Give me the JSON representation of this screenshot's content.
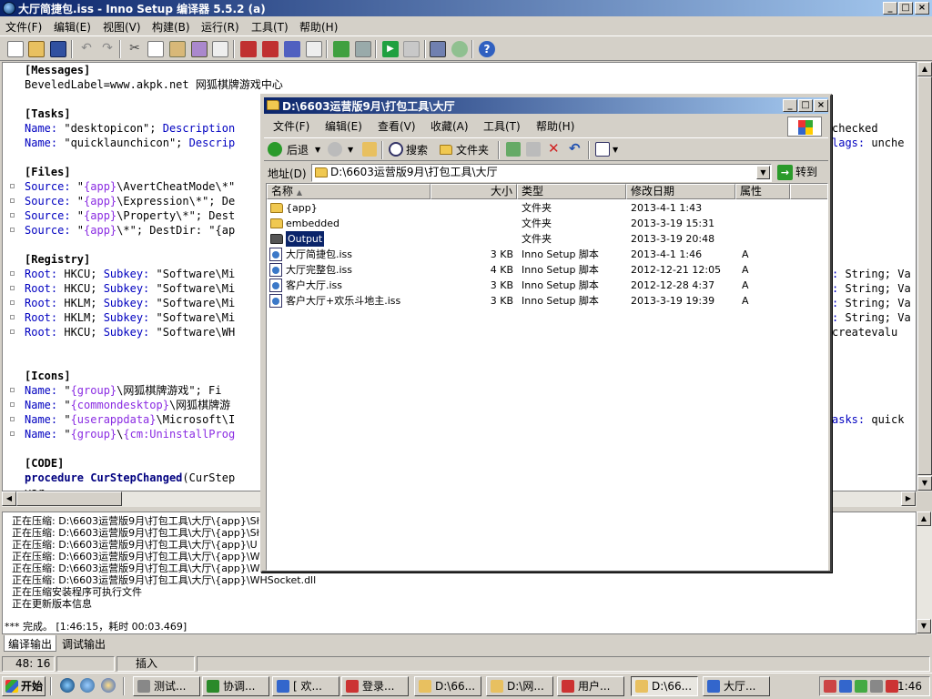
{
  "app": {
    "title": "大厅简捷包.iss - Inno Setup 编译器 5.5.2 (a)",
    "window_controls": [
      "_",
      "□",
      "×"
    ],
    "menu": [
      "文件(F)",
      "编辑(E)",
      "视图(V)",
      "构建(B)",
      "运行(R)",
      "工具(T)",
      "帮助(H)"
    ]
  },
  "editor": {
    "lines": [
      {
        "sec": "[Messages]"
      },
      {
        "plain": "BeveledLabel=www.akpk.net 网狐棋牌游戏中心"
      },
      {
        "blank": true
      },
      {
        "sec": "[Tasks]"
      },
      {
        "k": "Name:",
        "v": " \"desktopicon\"; ",
        "k2": "Description",
        "v2": ""
      },
      {
        "k": "Name:",
        "v": " \"quicklaunchicon\"; ",
        "k2": "Descrip",
        "v2": ""
      },
      {
        "blank": true
      },
      {
        "sec": "[Files]"
      },
      {
        "k": "Source:",
        "v": " \"",
        "c": "{app}",
        "v2": "\\AvertCheatMode\\*\"",
        "mark": true
      },
      {
        "k": "Source:",
        "v": " \"",
        "c": "{app}",
        "v2": "\\Expression\\*\"; De",
        "mark": true
      },
      {
        "k": "Source:",
        "v": " \"",
        "c": "{app}",
        "v2": "\\Property\\*\"; Dest",
        "mark": true
      },
      {
        "k": "Source:",
        "v": " \"",
        "c": "{app}",
        "v2": "\\*\"; DestDir: \"{ap",
        "mark": true
      },
      {
        "blank": true
      },
      {
        "sec": "[Registry]"
      },
      {
        "k": "Root:",
        "v": " HKCU; ",
        "k2": "Subkey:",
        "v2": " \"Software\\Mi",
        "mark": true
      },
      {
        "k": "Root:",
        "v": " HKCU; ",
        "k2": "Subkey:",
        "v2": " \"Software\\Mi",
        "mark": true
      },
      {
        "k": "Root:",
        "v": " HKLM; ",
        "k2": "Subkey:",
        "v2": " \"Software\\Mi",
        "mark": true
      },
      {
        "k": "Root:",
        "v": " HKLM; ",
        "k2": "Subkey:",
        "v2": " \"Software\\Mi",
        "mark": true
      },
      {
        "k": "Root:",
        "v": " HKCU; ",
        "k2": "Subkey:",
        "v2": " \"Software\\WH",
        "mark": true
      },
      {
        "blank": true
      },
      {
        "blank": true
      },
      {
        "sec": "[Icons]"
      },
      {
        "k": "Name:",
        "v": " \"",
        "c": "{group}",
        "v2": "\\网狐棋牌游戏\"; Fi",
        "mark": true
      },
      {
        "k": "Name:",
        "v": " \"",
        "c": "{commondesktop}",
        "v2": "\\网狐棋牌游",
        "mark": true
      },
      {
        "k": "Name:",
        "v": " \"",
        "c": "{userappdata}",
        "v2": "\\Microsoft\\I",
        "mark": true
      },
      {
        "k": "Name:",
        "v": " \"",
        "c": "{group}",
        "v2": "\\",
        "c2": "{cm:UninstallProg",
        "mark": true
      },
      {
        "blank": true
      },
      {
        "sec": "[CODE]"
      },
      {
        "proc": "procedure",
        "name": " CurStepChanged",
        "rest": "(CurStep"
      },
      {
        "plain": "var"
      }
    ],
    "right_fragments": [
      {
        "row": 4,
        "k": "",
        "text": "checked"
      },
      {
        "row": 5,
        "k": "lags:",
        "text": " unche"
      },
      {
        "row": 14,
        "k": ":",
        "text": " String; Va"
      },
      {
        "row": 15,
        "k": ":",
        "text": " String; Va"
      },
      {
        "row": 16,
        "k": ":",
        "text": " String; Va"
      },
      {
        "row": 17,
        "k": ":",
        "text": " String; Va"
      },
      {
        "row": 18,
        "k": "",
        "text": "createvalu"
      },
      {
        "row": 24,
        "k": "asks:",
        "text": " quick"
      }
    ]
  },
  "output": {
    "lines": [
      "正在压缩: D:\\6603运营版9月\\打包工具\\大厅\\{app}\\Sł",
      "正在压缩: D:\\6603运营版9月\\打包工具\\大厅\\{app}\\Sł",
      "正在压缩: D:\\6603运营版9月\\打包工具\\大厅\\{app}\\U",
      "正在压缩: D:\\6603运营版9月\\打包工具\\大厅\\{app}\\W",
      "正在压缩: D:\\6603运营版9月\\打包工具\\大厅\\{app}\\W",
      "正在压缩: D:\\6603运营版9月\\打包工具\\大厅\\{app}\\WHSocket.dll",
      "正在压缩安装程序可执行文件",
      "正在更新版本信息"
    ],
    "done": "*** 完成。 [1:46:15，耗时 00:03.469]",
    "tabs": [
      "编译输出",
      "调试输出"
    ]
  },
  "status": {
    "position": "48: 16",
    "mode": "插入"
  },
  "explorer": {
    "title": "D:\\6603运营版9月\\打包工具\\大厅",
    "menu": [
      "文件(F)",
      "编辑(E)",
      "查看(V)",
      "收藏(A)",
      "工具(T)",
      "帮助(H)"
    ],
    "toolbar": {
      "back": "后退",
      "search": "搜索",
      "folders": "文件夹"
    },
    "address": {
      "label": "地址(D)",
      "value": "D:\\6603运营版9月\\打包工具\\大厅",
      "go": "转到"
    },
    "columns": [
      "名称",
      "大小",
      "类型",
      "修改日期",
      "属性"
    ],
    "rows": [
      {
        "name": "{app}",
        "size": "",
        "type": "文件夹",
        "date": "2013-4-1 1:43",
        "attr": "",
        "icon": "folder"
      },
      {
        "name": "embedded",
        "size": "",
        "type": "文件夹",
        "date": "2013-3-19 15:31",
        "attr": "",
        "icon": "folder"
      },
      {
        "name": "Output",
        "size": "",
        "type": "文件夹",
        "date": "2013-3-19 20:48",
        "attr": "",
        "icon": "folder-dark",
        "selected": true
      },
      {
        "name": "大厅简捷包.iss",
        "size": "3 KB",
        "type": "Inno Setup 脚本",
        "date": "2013-4-1 1:46",
        "attr": "A",
        "icon": "iss"
      },
      {
        "name": "大厅完整包.iss",
        "size": "4 KB",
        "type": "Inno Setup 脚本",
        "date": "2012-12-21 12:05",
        "attr": "A",
        "icon": "iss"
      },
      {
        "name": "客户大厅.iss",
        "size": "3 KB",
        "type": "Inno Setup 脚本",
        "date": "2012-12-28 4:37",
        "attr": "A",
        "icon": "iss"
      },
      {
        "name": "客户大厅+欢乐斗地主.iss",
        "size": "3 KB",
        "type": "Inno Setup 脚本",
        "date": "2013-3-19 19:39",
        "attr": "A",
        "icon": "iss"
      }
    ]
  },
  "taskbar": {
    "start": "开始",
    "tasks": [
      "测试...",
      "协调...",
      "[ 欢...",
      "登录...",
      "D:\\66...",
      "D:\\网...",
      "用户...",
      "D:\\66...",
      "大厅..."
    ],
    "clock": "1:46"
  },
  "colors": {
    "titlebar_from": "#0a246a",
    "titlebar_to": "#a6caf0",
    "face": "#d4d0c8",
    "selection": "#0a246a"
  }
}
